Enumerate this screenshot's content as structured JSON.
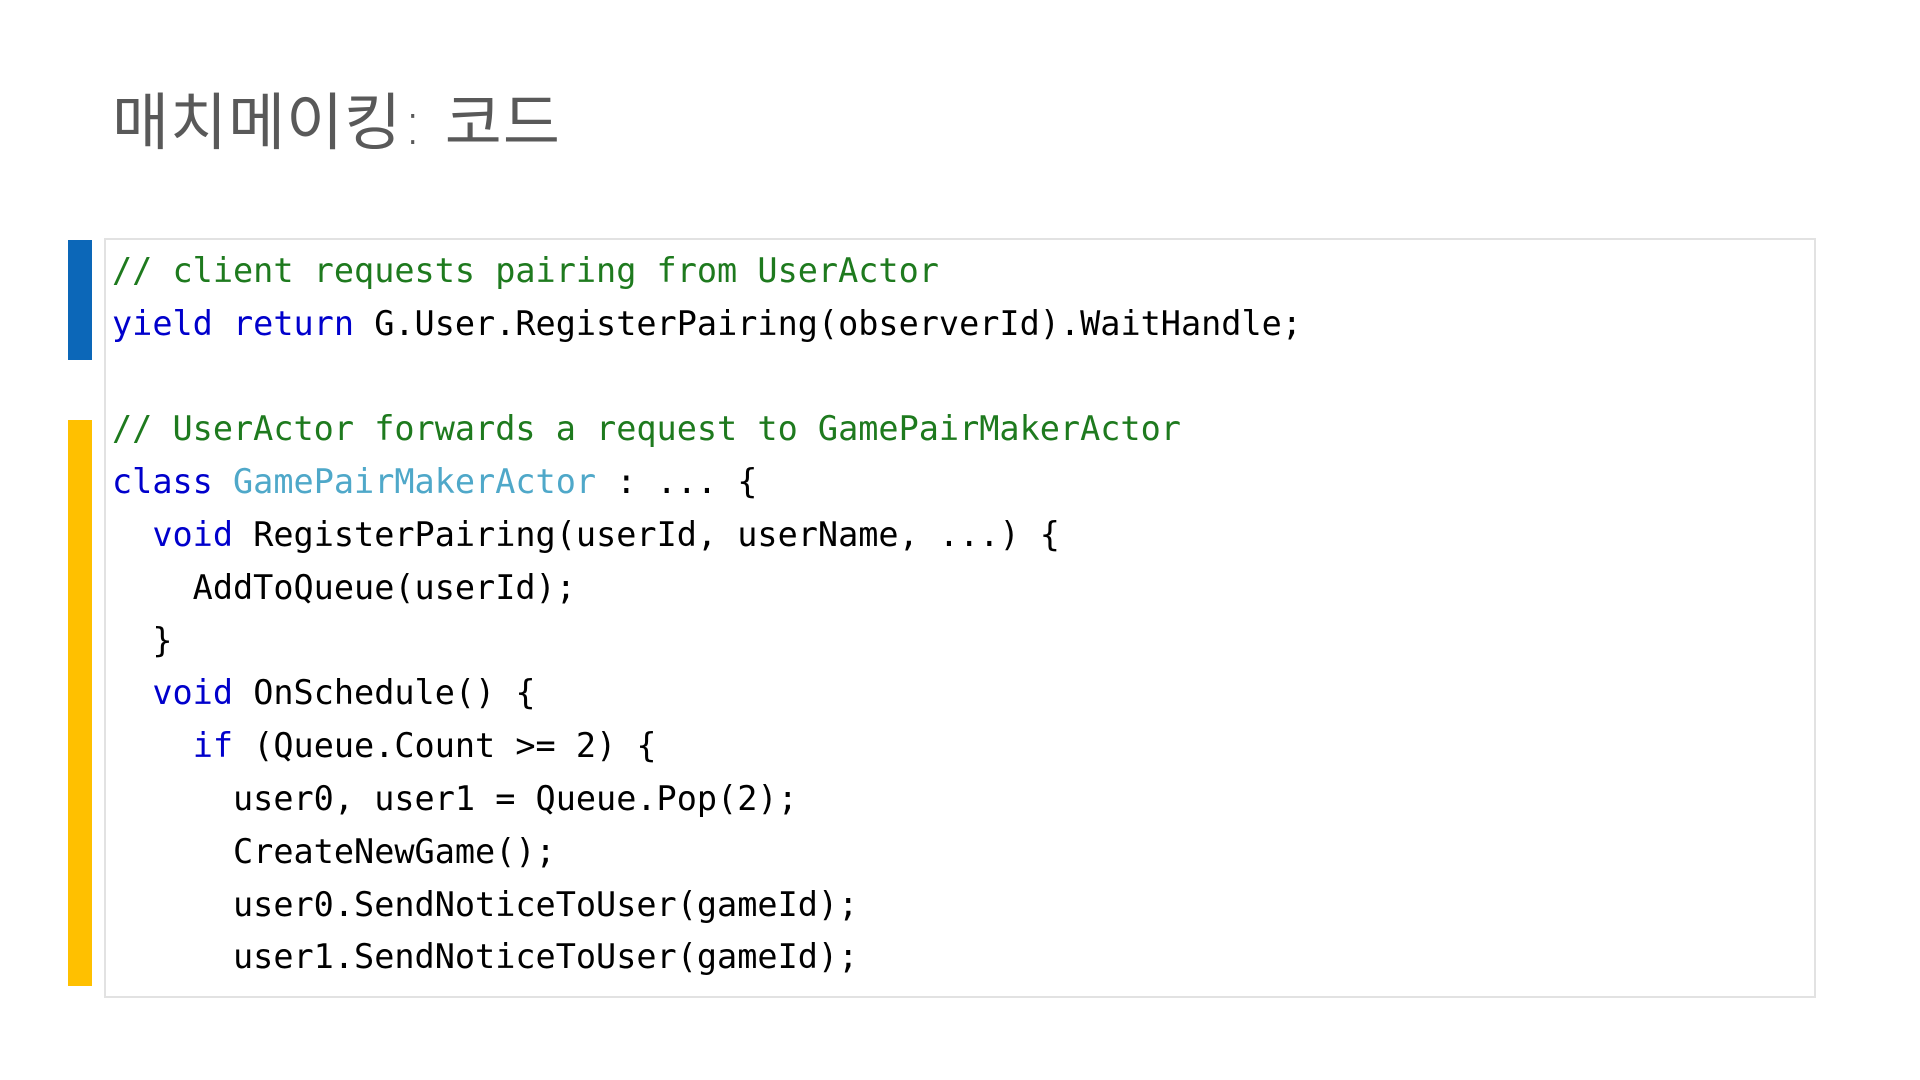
{
  "slide": {
    "title": "매치메이킹: 코드",
    "title_color": "#595959",
    "background_color": "#ffffff"
  },
  "accents": {
    "blue_bar_color": "#0c67b8",
    "orange_bar_color": "#ffc000"
  },
  "code_panel": {
    "border_color": "#e2e2e2",
    "background_color": "#ffffff",
    "syntax_colors": {
      "comment": "#1e7a1e",
      "keyword": "#0000cc",
      "type": "#4fa8c9",
      "plain": "#000000"
    },
    "lines": [
      {
        "id": "l1",
        "text": "// client requests pairing from UserActor"
      },
      {
        "id": "l2",
        "text": "yield return G.User.RegisterPairing(observerId).WaitHandle;"
      },
      {
        "id": "l3",
        "text": ""
      },
      {
        "id": "l4",
        "text": "// UserActor forwards a request to GamePairMakerActor"
      },
      {
        "id": "l5",
        "text": "class GamePairMakerActor : ... {"
      },
      {
        "id": "l6",
        "text": "  void RegisterPairing(userId, userName, ...) {"
      },
      {
        "id": "l7",
        "text": "    AddToQueue(userId);"
      },
      {
        "id": "l8",
        "text": "  }"
      },
      {
        "id": "l9",
        "text": "  void OnSchedule() {"
      },
      {
        "id": "l10",
        "text": "    if (Queue.Count >= 2) {"
      },
      {
        "id": "l11",
        "text": "      user0, user1 = Queue.Pop(2);"
      },
      {
        "id": "l12",
        "text": "      CreateNewGame();"
      },
      {
        "id": "l13",
        "text": "      user0.SendNoticeToUser(gameId);"
      },
      {
        "id": "l14",
        "text": "      user1.SendNoticeToUser(gameId);"
      }
    ],
    "segments": [
      [
        {
          "t": "// client requests pairing from UserActor",
          "c": "comment"
        }
      ],
      [
        {
          "t": "yield return",
          "c": "keyword"
        },
        {
          "t": " G.User.RegisterPairing(observerId).WaitHandle;",
          "c": "plain"
        }
      ],
      [
        {
          "t": "",
          "c": "plain"
        }
      ],
      [
        {
          "t": "// UserActor forwards a request to GamePairMakerActor",
          "c": "comment"
        }
      ],
      [
        {
          "t": "class",
          "c": "keyword"
        },
        {
          "t": " ",
          "c": "plain"
        },
        {
          "t": "GamePairMakerActor",
          "c": "type"
        },
        {
          "t": " : ... {",
          "c": "plain"
        }
      ],
      [
        {
          "t": "  ",
          "c": "plain"
        },
        {
          "t": "void",
          "c": "keyword"
        },
        {
          "t": " RegisterPairing(userId, userName, ...) {",
          "c": "plain"
        }
      ],
      [
        {
          "t": "    AddToQueue(userId);",
          "c": "plain"
        }
      ],
      [
        {
          "t": "  }",
          "c": "plain"
        }
      ],
      [
        {
          "t": "  ",
          "c": "plain"
        },
        {
          "t": "void",
          "c": "keyword"
        },
        {
          "t": " OnSchedule() {",
          "c": "plain"
        }
      ],
      [
        {
          "t": "    ",
          "c": "plain"
        },
        {
          "t": "if",
          "c": "keyword"
        },
        {
          "t": " (Queue.Count >= 2) {",
          "c": "plain"
        }
      ],
      [
        {
          "t": "      user0, user1 = Queue.Pop(2);",
          "c": "plain"
        }
      ],
      [
        {
          "t": "      CreateNewGame();",
          "c": "plain"
        }
      ],
      [
        {
          "t": "      user0.SendNoticeToUser(gameId);",
          "c": "plain"
        }
      ],
      [
        {
          "t": "      user1.SendNoticeToUser(gameId);",
          "c": "plain"
        }
      ]
    ]
  }
}
